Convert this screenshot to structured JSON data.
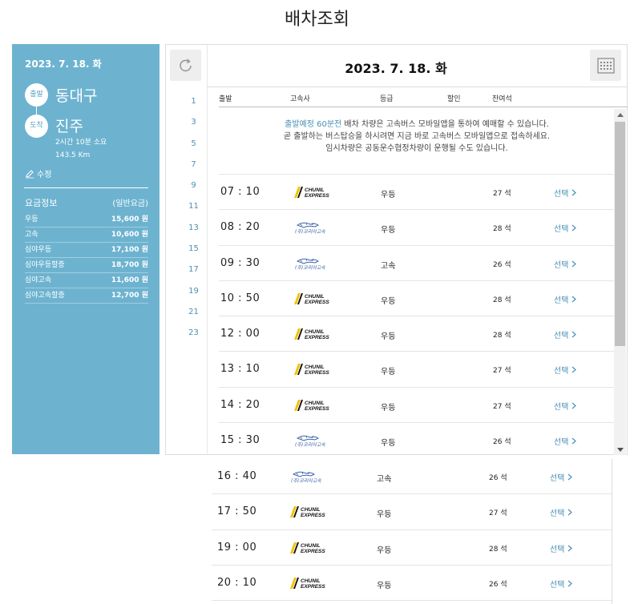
{
  "page": {
    "title": "배차조회"
  },
  "info": {
    "date": "2023. 7. 18. 화",
    "departure_label": "출발",
    "departure": "동대구",
    "arrival_label": "도착",
    "arrival": "진주",
    "duration": "2시간 10분 소요",
    "distance": "143.5 Km",
    "edit_label": "수정"
  },
  "fares": {
    "title": "요금정보",
    "subtitle": "(일반요금)",
    "items": [
      {
        "grade": "우등",
        "price": "15,600 원"
      },
      {
        "grade": "고속",
        "price": "10,600 원"
      },
      {
        "grade": "심야우등",
        "price": "17,100 원"
      },
      {
        "grade": "심야우등할증",
        "price": "18,700 원"
      },
      {
        "grade": "심야고속",
        "price": "11,600 원"
      },
      {
        "grade": "심야고속할증",
        "price": "12,700 원"
      }
    ]
  },
  "schedule": {
    "selected_date": "2023. 7. 18. 화",
    "hours": [
      "1",
      "3",
      "5",
      "7",
      "9",
      "11",
      "13",
      "15",
      "17",
      "19",
      "21",
      "23"
    ],
    "columns": {
      "depart": "출발",
      "company": "고속사",
      "grade": "등급",
      "discount": "할인",
      "seats": "잔여석"
    },
    "notice": {
      "highlight": "출발예정 60분전",
      "line1": " 배차 차량은 고속버스 모바일앱을 통하여 예매할 수 있습니다.",
      "line2": "곧 출발하는 버스탑승을 하시려면 지금 바로 고속버스 모바일앱으로 접속하세요.",
      "line3": "임시차량은 공동운수협정차량이 운행될 수도 있습니다."
    },
    "logos": {
      "chunil_line1": "CHUNIL",
      "chunil_line2": "EXPRESS",
      "kobus": "(주)코리아고속"
    },
    "buses": [
      {
        "time": "07 : 10",
        "company": "chunil",
        "grade": "우등",
        "seats": "27 석",
        "select": "선택"
      },
      {
        "time": "08 : 20",
        "company": "kobus",
        "grade": "우등",
        "seats": "28 석",
        "select": "선택"
      },
      {
        "time": "09 : 30",
        "company": "kobus",
        "grade": "고속",
        "seats": "26 석",
        "select": "선택"
      },
      {
        "time": "10 : 50",
        "company": "chunil",
        "grade": "우등",
        "seats": "28 석",
        "select": "선택"
      },
      {
        "time": "12 : 00",
        "company": "chunil",
        "grade": "우등",
        "seats": "28 석",
        "select": "선택"
      },
      {
        "time": "13 : 10",
        "company": "chunil",
        "grade": "우등",
        "seats": "27 석",
        "select": "선택"
      },
      {
        "time": "14 : 20",
        "company": "chunil",
        "grade": "우등",
        "seats": "27 석",
        "select": "선택"
      },
      {
        "time": "15 : 30",
        "company": "kobus",
        "grade": "우등",
        "seats": "26 석",
        "select": "선택"
      }
    ],
    "overflow_buses": [
      {
        "time": "16 : 40",
        "company": "kobus",
        "grade": "고속",
        "seats": "26 석",
        "select": "선택"
      },
      {
        "time": "17 : 50",
        "company": "chunil",
        "grade": "우등",
        "seats": "27 석",
        "select": "선택"
      },
      {
        "time": "19 : 00",
        "company": "chunil",
        "grade": "우등",
        "seats": "28 석",
        "select": "선택"
      },
      {
        "time": "20 : 10",
        "company": "chunil",
        "grade": "우등",
        "seats": "26 석",
        "select": "선택"
      }
    ]
  },
  "colors": {
    "panel": "#6db3d0",
    "accent": "#4a90b5",
    "chunil_yellow": "#f2c200",
    "kobus_blue": "#3c63a8"
  },
  "icons": {
    "refresh": "refresh-icon",
    "calendar": "calendar-icon",
    "edit": "pencil-icon",
    "chevron": "chevron-right-icon"
  }
}
